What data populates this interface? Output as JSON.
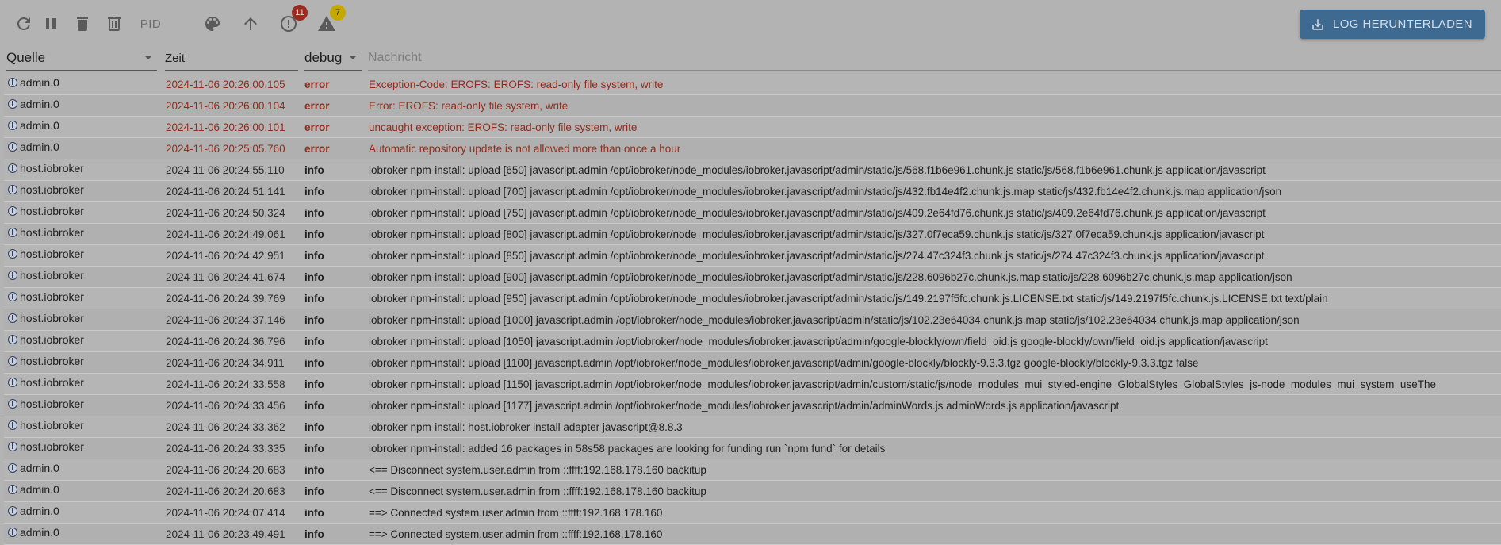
{
  "toolbar": {
    "pid_label": "PID",
    "error_count": "11",
    "warning_count": "7",
    "download_label": "LOG HERUNTERLADEN"
  },
  "columns": {
    "source": "Quelle",
    "time": "Zeit",
    "severity": "debug",
    "message_placeholder": "Nachricht"
  },
  "colors": {
    "error": "#8f2d1e",
    "accent": "#3e6990",
    "error_badge": "#9c2a20",
    "warning_badge": "#c4a800"
  },
  "rows": [
    {
      "source": "admin.0",
      "time": "2024-11-06 20:26:00.105",
      "severity": "error",
      "message": "Exception-Code: EROFS: EROFS: read-only file system, write"
    },
    {
      "source": "admin.0",
      "time": "2024-11-06 20:26:00.104",
      "severity": "error",
      "message": "Error: EROFS: read-only file system, write"
    },
    {
      "source": "admin.0",
      "time": "2024-11-06 20:26:00.101",
      "severity": "error",
      "message": "uncaught exception: EROFS: read-only file system, write"
    },
    {
      "source": "admin.0",
      "time": "2024-11-06 20:25:05.760",
      "severity": "error",
      "message": "Automatic repository update is not allowed more than once a hour"
    },
    {
      "source": "host.iobroker",
      "time": "2024-11-06 20:24:55.110",
      "severity": "info",
      "message": "iobroker npm-install: upload [650] javascript.admin /opt/iobroker/node_modules/iobroker.javascript/admin/static/js/568.f1b6e961.chunk.js static/js/568.f1b6e961.chunk.js application/javascript"
    },
    {
      "source": "host.iobroker",
      "time": "2024-11-06 20:24:51.141",
      "severity": "info",
      "message": "iobroker npm-install: upload [700] javascript.admin /opt/iobroker/node_modules/iobroker.javascript/admin/static/js/432.fb14e4f2.chunk.js.map static/js/432.fb14e4f2.chunk.js.map application/json"
    },
    {
      "source": "host.iobroker",
      "time": "2024-11-06 20:24:50.324",
      "severity": "info",
      "message": "iobroker npm-install: upload [750] javascript.admin /opt/iobroker/node_modules/iobroker.javascript/admin/static/js/409.2e64fd76.chunk.js static/js/409.2e64fd76.chunk.js application/javascript"
    },
    {
      "source": "host.iobroker",
      "time": "2024-11-06 20:24:49.061",
      "severity": "info",
      "message": "iobroker npm-install: upload [800] javascript.admin /opt/iobroker/node_modules/iobroker.javascript/admin/static/js/327.0f7eca59.chunk.js static/js/327.0f7eca59.chunk.js application/javascript"
    },
    {
      "source": "host.iobroker",
      "time": "2024-11-06 20:24:42.951",
      "severity": "info",
      "message": "iobroker npm-install: upload [850] javascript.admin /opt/iobroker/node_modules/iobroker.javascript/admin/static/js/274.47c324f3.chunk.js static/js/274.47c324f3.chunk.js application/javascript"
    },
    {
      "source": "host.iobroker",
      "time": "2024-11-06 20:24:41.674",
      "severity": "info",
      "message": "iobroker npm-install: upload [900] javascript.admin /opt/iobroker/node_modules/iobroker.javascript/admin/static/js/228.6096b27c.chunk.js.map static/js/228.6096b27c.chunk.js.map application/json"
    },
    {
      "source": "host.iobroker",
      "time": "2024-11-06 20:24:39.769",
      "severity": "info",
      "message": "iobroker npm-install: upload [950] javascript.admin /opt/iobroker/node_modules/iobroker.javascript/admin/static/js/149.2197f5fc.chunk.js.LICENSE.txt static/js/149.2197f5fc.chunk.js.LICENSE.txt text/plain"
    },
    {
      "source": "host.iobroker",
      "time": "2024-11-06 20:24:37.146",
      "severity": "info",
      "message": "iobroker npm-install: upload [1000] javascript.admin /opt/iobroker/node_modules/iobroker.javascript/admin/static/js/102.23e64034.chunk.js.map static/js/102.23e64034.chunk.js.map application/json"
    },
    {
      "source": "host.iobroker",
      "time": "2024-11-06 20:24:36.796",
      "severity": "info",
      "message": "iobroker npm-install: upload [1050] javascript.admin /opt/iobroker/node_modules/iobroker.javascript/admin/google-blockly/own/field_oid.js google-blockly/own/field_oid.js application/javascript"
    },
    {
      "source": "host.iobroker",
      "time": "2024-11-06 20:24:34.911",
      "severity": "info",
      "message": "iobroker npm-install: upload [1100] javascript.admin /opt/iobroker/node_modules/iobroker.javascript/admin/google-blockly/blockly-9.3.3.tgz google-blockly/blockly-9.3.3.tgz false"
    },
    {
      "source": "host.iobroker",
      "time": "2024-11-06 20:24:33.558",
      "severity": "info",
      "message": "iobroker npm-install: upload [1150] javascript.admin /opt/iobroker/node_modules/iobroker.javascript/admin/custom/static/js/node_modules_mui_styled-engine_GlobalStyles_GlobalStyles_js-node_modules_mui_system_useThe"
    },
    {
      "source": "host.iobroker",
      "time": "2024-11-06 20:24:33.456",
      "severity": "info",
      "message": "iobroker npm-install: upload [1177] javascript.admin /opt/iobroker/node_modules/iobroker.javascript/admin/adminWords.js adminWords.js application/javascript"
    },
    {
      "source": "host.iobroker",
      "time": "2024-11-06 20:24:33.362",
      "severity": "info",
      "message": "iobroker npm-install: host.iobroker install adapter javascript@8.8.3"
    },
    {
      "source": "host.iobroker",
      "time": "2024-11-06 20:24:33.335",
      "severity": "info",
      "message": "iobroker npm-install: added 16 packages in 58s58 packages are looking for funding run `npm fund` for details"
    },
    {
      "source": "admin.0",
      "time": "2024-11-06 20:24:20.683",
      "severity": "info",
      "message": "<== Disconnect system.user.admin from ::ffff:192.168.178.160 backitup"
    },
    {
      "source": "admin.0",
      "time": "2024-11-06 20:24:20.683",
      "severity": "info",
      "message": "<== Disconnect system.user.admin from ::ffff:192.168.178.160 backitup"
    },
    {
      "source": "admin.0",
      "time": "2024-11-06 20:24:07.414",
      "severity": "info",
      "message": "==> Connected system.user.admin from ::ffff:192.168.178.160"
    },
    {
      "source": "admin.0",
      "time": "2024-11-06 20:23:49.491",
      "severity": "info",
      "message": "==> Connected system.user.admin from ::ffff:192.168.178.160"
    }
  ]
}
